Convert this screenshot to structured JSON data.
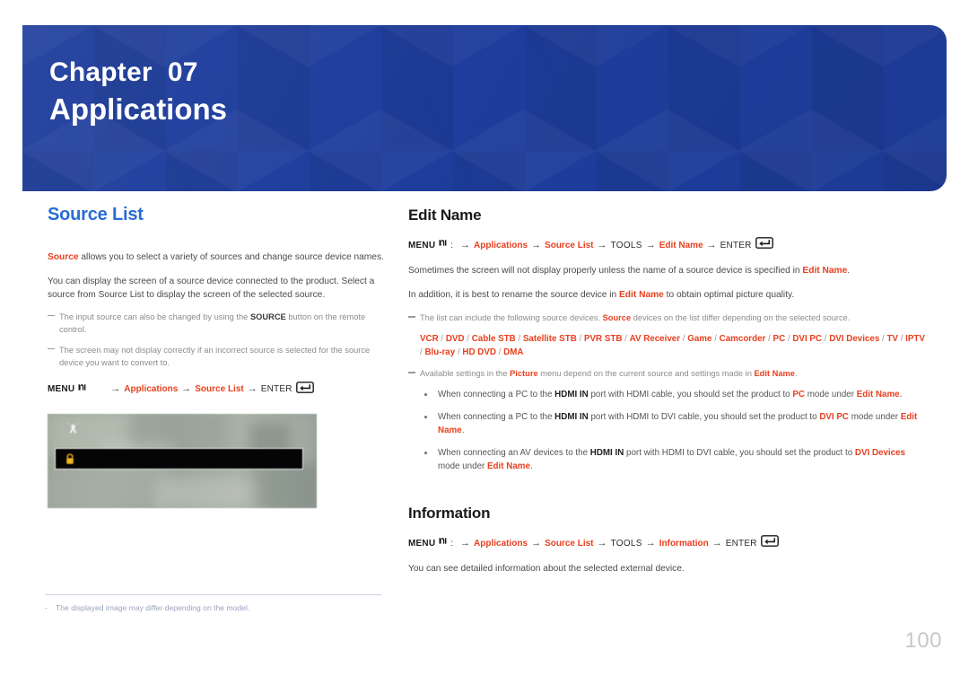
{
  "banner": {
    "chapter_label": "Chapter  07",
    "chapter_title": "Applications",
    "bg_color": "#1e3d9c"
  },
  "left_column": {
    "heading": "Source List",
    "heading_color": "#2a6cd4",
    "paragraphs": [
      {
        "lead": "Source",
        "rest": " allows you to select a variety of sources and change source device names."
      },
      {
        "text": "You can display the screen of a source device connected to the product. Select a source from Source List to display the screen of the selected source."
      }
    ],
    "notes": [
      {
        "pre": "The input source can also be changed by using the ",
        "bold": "SOURCE",
        "post": " button on the remote control."
      },
      {
        "pre": "The screen may not display correctly if an incorrect source is selected for the source device you want to convert to.",
        "bold": "",
        "post": ""
      }
    ],
    "menu_path": {
      "menu": "MENU",
      "menu_icon": "menu-remote-icon",
      "steps": [
        "Applications",
        "Source List"
      ],
      "enter": "ENTER",
      "enter_icon": "enter-return-icon",
      "arrow": "→"
    },
    "thumbnail": {
      "name": "source-list-screenshot-thumbnail",
      "badge_icon": "broadcast-icon",
      "lock_icon": "lock-icon"
    }
  },
  "right_column": {
    "edit_name": {
      "heading": "Edit Name",
      "menu_path": {
        "menu": "MENU",
        "menu_icon": "menu-remote-icon",
        "colon": ":",
        "steps_orange_1": "Applications",
        "steps_orange_2": "Source List",
        "tools": "TOOLS",
        "steps_orange_3": "Edit Name",
        "enter": "ENTER",
        "enter_icon": "enter-return-icon",
        "arrow": "→"
      },
      "paragraphs": [
        {
          "pre": "Sometimes the screen will not display properly unless the name of a source device is specified in ",
          "red": "Edit Name",
          "post": "."
        },
        {
          "pre": "In addition, it is best to rename the source device in ",
          "red": "Edit Name",
          "post": " to obtain optimal picture quality."
        }
      ],
      "note_source_list": {
        "pre": "The list can include the following source devices. ",
        "red": "Source",
        "post": " devices on the list differ depending on the selected source."
      },
      "device_list": [
        "VCR",
        "DVD",
        "Cable STB",
        "Satellite STB",
        "PVR STB",
        "AV Receiver",
        "Game",
        "Camcorder",
        "PC",
        "DVI PC",
        "DVI Devices",
        "TV",
        "IPTV",
        "Blu-ray",
        "HD DVD",
        "DMA"
      ],
      "device_list_separator": "/",
      "note_picture": {
        "pre": "Available settings in the ",
        "red1": "Picture",
        "mid": " menu depend on the current source and settings made in ",
        "red2": "Edit Name",
        "post": "."
      },
      "bullets": [
        {
          "p1": "When connecting a PC to the ",
          "b1": "HDMI IN",
          "p2": " port with HDMI cable, you should set the product to ",
          "r1": "PC",
          "p3": " mode under ",
          "r2": "Edit Name",
          "p4": "."
        },
        {
          "p1": "When connecting a PC to the ",
          "b1": "HDMI IN",
          "p2": " port with HDMI to DVI cable, you should set the product to ",
          "r1": "DVI PC",
          "p3": " mode under ",
          "r2": "Edit Name",
          "p4": "."
        },
        {
          "p1": "When connecting an AV devices to the ",
          "b1": "HDMI IN",
          "p2": " port with HDMI to DVI cable, you should set the product to ",
          "r1": "DVI Devices",
          "p3": " mode under ",
          "r2": "Edit Name",
          "p4": "."
        }
      ]
    },
    "information": {
      "heading": "Information",
      "menu_path": {
        "menu": "MENU",
        "menu_icon": "menu-remote-icon",
        "colon": ":",
        "steps_orange_1": "Applications",
        "steps_orange_2": "Source List",
        "tools": "TOOLS",
        "steps_orange_3": "Information",
        "enter": "ENTER",
        "enter_icon": "enter-return-icon",
        "arrow": "→"
      },
      "body": "You can see detailed information about the selected external device."
    }
  },
  "footer": {
    "dash": "-",
    "note": "The displayed image may differ depending on the model.",
    "page_number": "100"
  },
  "colors": {
    "accent_red": "#e8401f",
    "accent_blue": "#2a6cd4",
    "banner_blue": "#1e3d9c",
    "muted_grey": "#8c8c8c",
    "footer_blue_grey": "#9aa3bb"
  }
}
